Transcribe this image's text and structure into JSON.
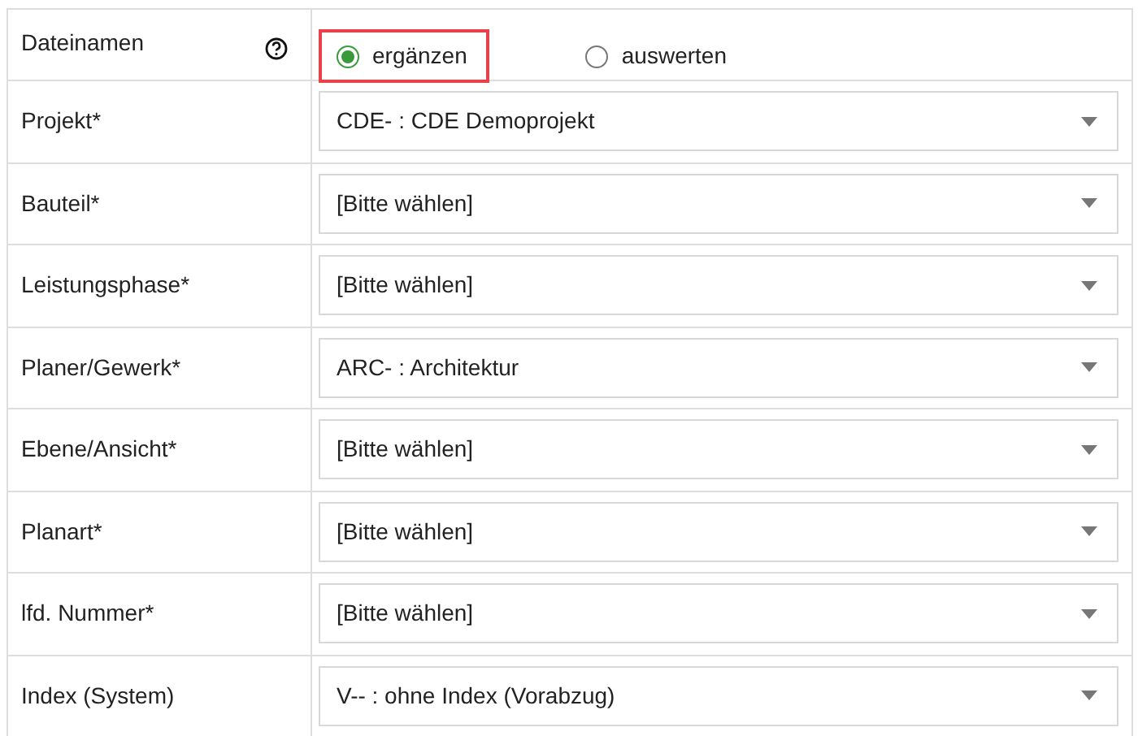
{
  "filename_row": {
    "label": "Dateinamen",
    "options": [
      {
        "label": "ergänzen",
        "selected": true,
        "highlighted": true
      },
      {
        "label": "auswerten",
        "selected": false,
        "highlighted": false
      }
    ]
  },
  "fields": [
    {
      "label": "Projekt*",
      "value": "CDE- : CDE Demoprojekt"
    },
    {
      "label": "Bauteil*",
      "value": "[Bitte wählen]"
    },
    {
      "label": "Leistungsphase*",
      "value": "[Bitte wählen]"
    },
    {
      "label": "Planer/Gewerk*",
      "value": "ARC- : Architektur"
    },
    {
      "label": "Ebene/Ansicht*",
      "value": "[Bitte wählen]"
    },
    {
      "label": "Planart*",
      "value": "[Bitte wählen]"
    },
    {
      "label": "lfd. Nummer*",
      "value": "[Bitte wählen]"
    },
    {
      "label": "Index (System)",
      "value": "V-- : ohne Index (Vorabzug)"
    }
  ]
}
